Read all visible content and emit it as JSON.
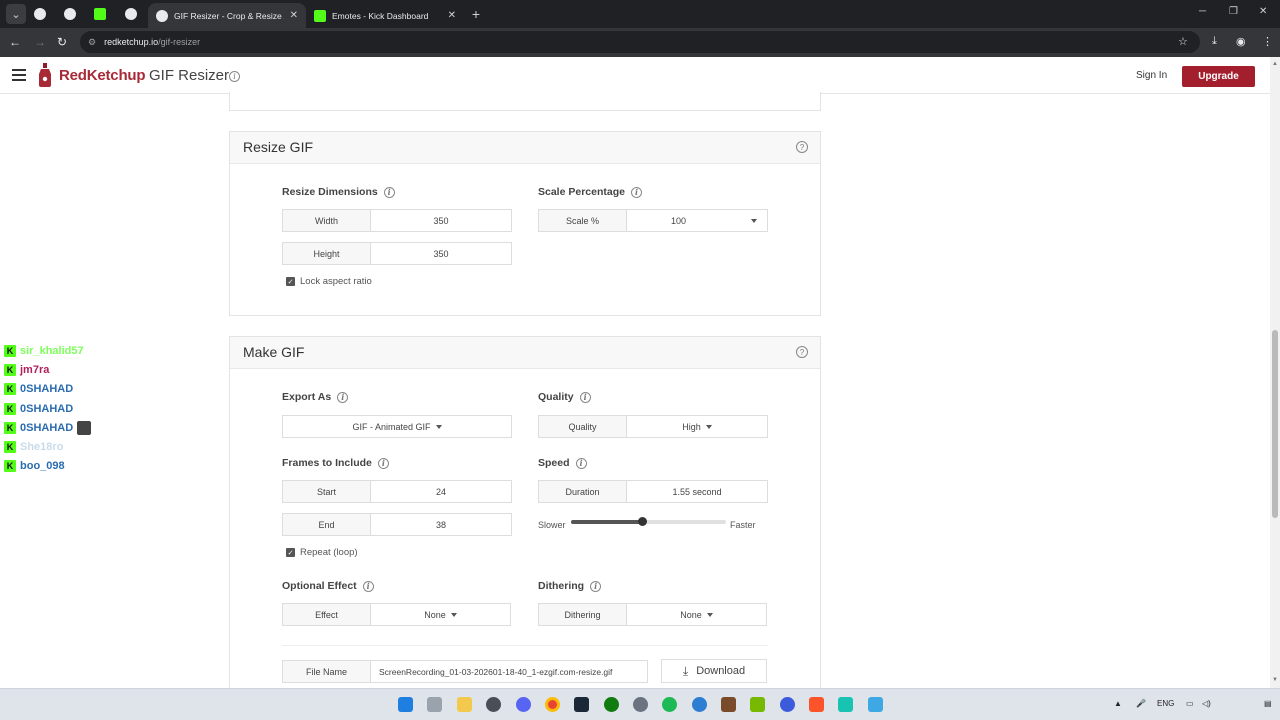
{
  "browser": {
    "tabs": [
      {
        "title": "GIF Resizer - Crop & Resize Animated GIF",
        "active": true
      },
      {
        "title": "Emotes - Kick Dashboard",
        "active": false
      }
    ],
    "url_host": "redketchup.io",
    "url_path": "/gif-resizer"
  },
  "header": {
    "brand": "RedKetchup",
    "title": "GIF Resizer",
    "signin": "Sign In",
    "upgrade": "Upgrade"
  },
  "resize": {
    "title": "Resize GIF",
    "dimensions_label": "Resize Dimensions",
    "width_label": "Width",
    "width_value": "350",
    "height_label": "Height",
    "height_value": "350",
    "lock_label": "Lock aspect ratio",
    "scale_label": "Scale Percentage",
    "scale_key": "Scale %",
    "scale_value": "100"
  },
  "make": {
    "title": "Make GIF",
    "export_label": "Export As",
    "export_value": "GIF - Animated GIF",
    "quality_label": "Quality",
    "quality_key": "Quality",
    "quality_value": "High",
    "frames_label": "Frames to Include",
    "start_label": "Start",
    "start_value": "24",
    "end_label": "End",
    "end_value": "38",
    "repeat_label": "Repeat (loop)",
    "speed_label": "Speed",
    "duration_key": "Duration",
    "duration_value": "1.55 second",
    "slower": "Slower",
    "faster": "Faster",
    "speed_fraction": 0.46,
    "effect_label": "Optional Effect",
    "effect_key": "Effect",
    "effect_value": "None",
    "dither_label": "Dithering",
    "dither_key": "Dithering",
    "dither_value": "None",
    "file_key": "File Name",
    "file_value": "ScreenRecording_01-03-202601-18-40_1-ezgif.com-resize.gif",
    "download": "Download"
  },
  "chat": [
    {
      "user": "sir_khalid57",
      "color": "#7cff5a"
    },
    {
      "user": "jm7ra",
      "color": "#b0205a"
    },
    {
      "user": "0SHAHAD",
      "color": "#2a6cb0"
    },
    {
      "user": "0SHAHAD",
      "color": "#2a6cb0"
    },
    {
      "user": "0SHAHAD",
      "color": "#2a6cb0"
    },
    {
      "user": "She18ro",
      "color": "#c9dbe9"
    },
    {
      "user": "boo_098",
      "color": "#2a6cb0"
    }
  ],
  "tray": {
    "lang": "ENG"
  },
  "colors": {
    "brand": "#a82a36",
    "upgrade_bg": "#a41f2e",
    "kick_green": "#53fc18"
  }
}
